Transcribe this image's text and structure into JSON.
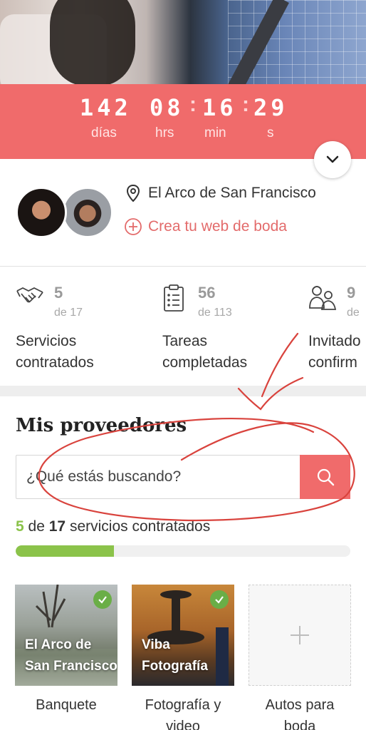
{
  "countdown": {
    "days": "142",
    "hours": "08",
    "minutes": "16",
    "seconds": "29",
    "days_label": "días",
    "hours_label": "hrs",
    "minutes_label": "min",
    "seconds_label": "s",
    "separator": ":"
  },
  "couple": {
    "venue": "El Arco de San Francisco",
    "create_web": "Crea tu web de boda"
  },
  "stats": [
    {
      "value": "5",
      "total": "de 17",
      "label_line1": "Servicios",
      "label_line2": "contratados",
      "icon": "handshake-icon"
    },
    {
      "value": "56",
      "total": "de 113",
      "label_line1": "Tareas",
      "label_line2": "completadas",
      "icon": "clipboard-icon"
    },
    {
      "value": "9",
      "total": "de",
      "label_line1": "Invitado",
      "label_line2": "confirm",
      "icon": "guests-icon"
    }
  ],
  "providers": {
    "title": "Mis proveedores",
    "search_placeholder": "¿Qué estás buscando?",
    "progress": {
      "done": "5",
      "of": "de",
      "total": "17",
      "suffix": "servicios contratados",
      "fraction": 0.294
    },
    "cards": [
      {
        "thumb_text": "El Arco de San Francisco",
        "caption": "Banquete",
        "checked": true
      },
      {
        "thumb_text": "Viba Fotografía",
        "caption": "Fotografía y video",
        "checked": true
      },
      {
        "thumb_text": "",
        "caption": "Autos para boda",
        "checked": false
      }
    ]
  },
  "colors": {
    "accent": "#f06b6b",
    "success": "#8bc34a",
    "check": "#6aae47"
  }
}
